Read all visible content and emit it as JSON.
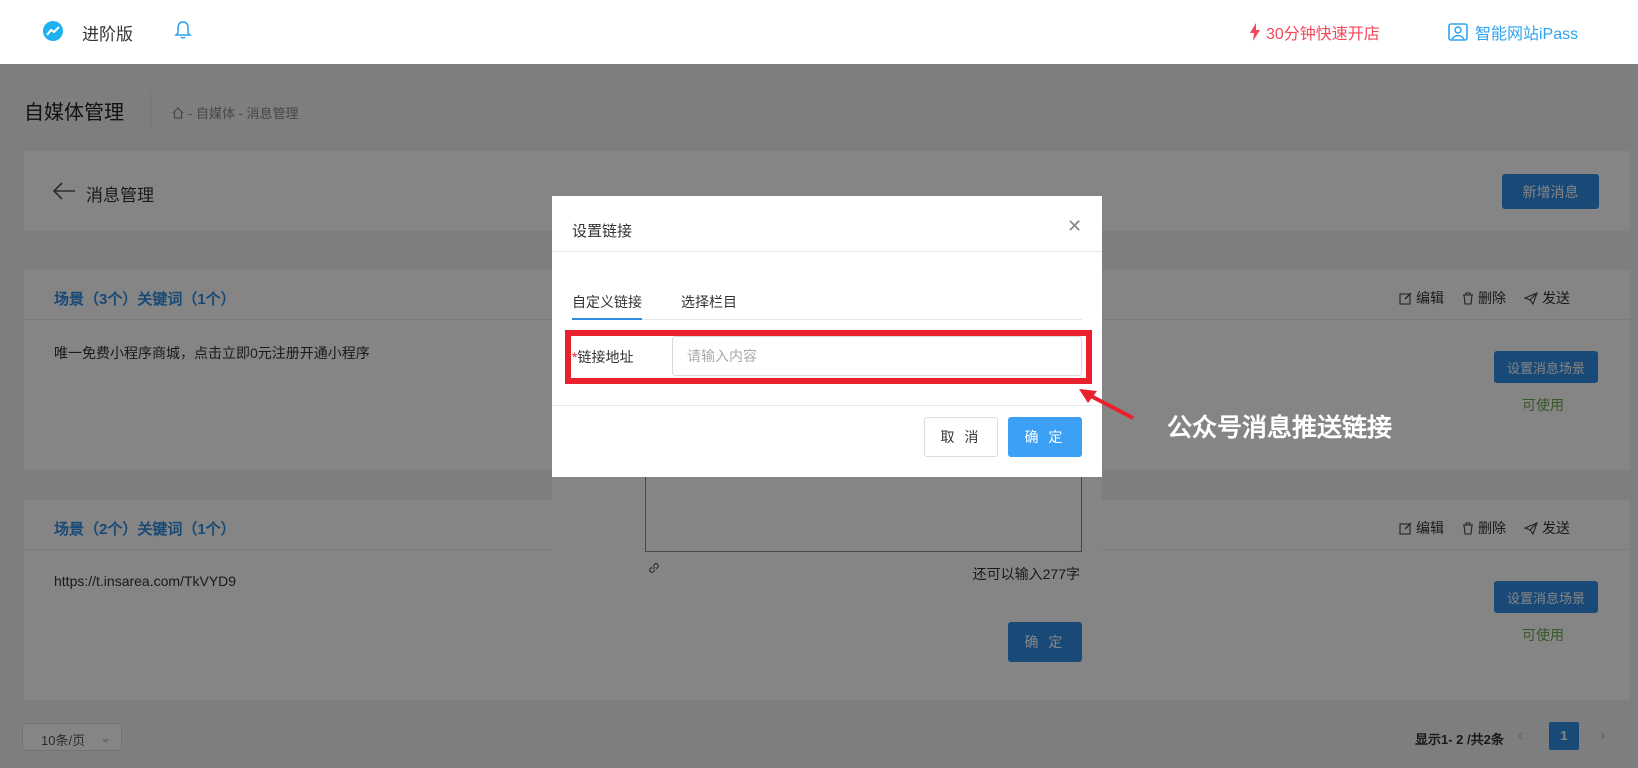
{
  "topbar": {
    "edition": "进阶版",
    "promo": "30分钟快速开店",
    "ipass": "智能网站iPass",
    "colors": {
      "promo": "#f5475b",
      "ipass": "#2ea3f2"
    }
  },
  "page": {
    "title": "自媒体管理",
    "breadcrumb": "- 自媒体 - 消息管理"
  },
  "header": {
    "title": "消息管理",
    "add_button": "新增消息"
  },
  "messages": [
    {
      "title": "场景（3个）关键词（1个）",
      "body": "唯一免费小程序商城，点击立即0元注册开通小程序",
      "actions": {
        "edit": "编辑",
        "delete": "删除",
        "send": "发送"
      },
      "scene_button": "设置消息场景",
      "status": "可使用"
    },
    {
      "title": "场景（2个）关键词（1个）",
      "body": "https://t.insarea.com/TkVYD9",
      "actions": {
        "edit": "编辑",
        "delete": "删除",
        "send": "发送"
      },
      "scene_button": "设置消息场景",
      "status": "可使用"
    }
  ],
  "pagination": {
    "page_size": "10条/页",
    "info": "显示1- 2 /共2条",
    "current_page": "1"
  },
  "underlying_dialog": {
    "remaining": "还可以输入277字",
    "confirm": "确 定"
  },
  "link_dialog": {
    "title": "设置链接",
    "tabs": [
      "自定义链接",
      "选择栏目"
    ],
    "active_tab": "自定义链接",
    "field_label": "链接地址",
    "required_mark": "*",
    "input_value": "",
    "input_placeholder": "请输入内容",
    "cancel": "取 消",
    "ok": "确 定"
  },
  "annotation": {
    "text": "公众号消息推送链接",
    "color": "#e8212c"
  },
  "icons": [
    "trend-logo-icon",
    "bell-icon",
    "lightning-icon",
    "profile-frame-icon",
    "home-icon",
    "back-arrow-icon",
    "edit-icon",
    "trash-icon",
    "send-icon",
    "link-icon",
    "close-icon",
    "chevron-down-icon"
  ]
}
